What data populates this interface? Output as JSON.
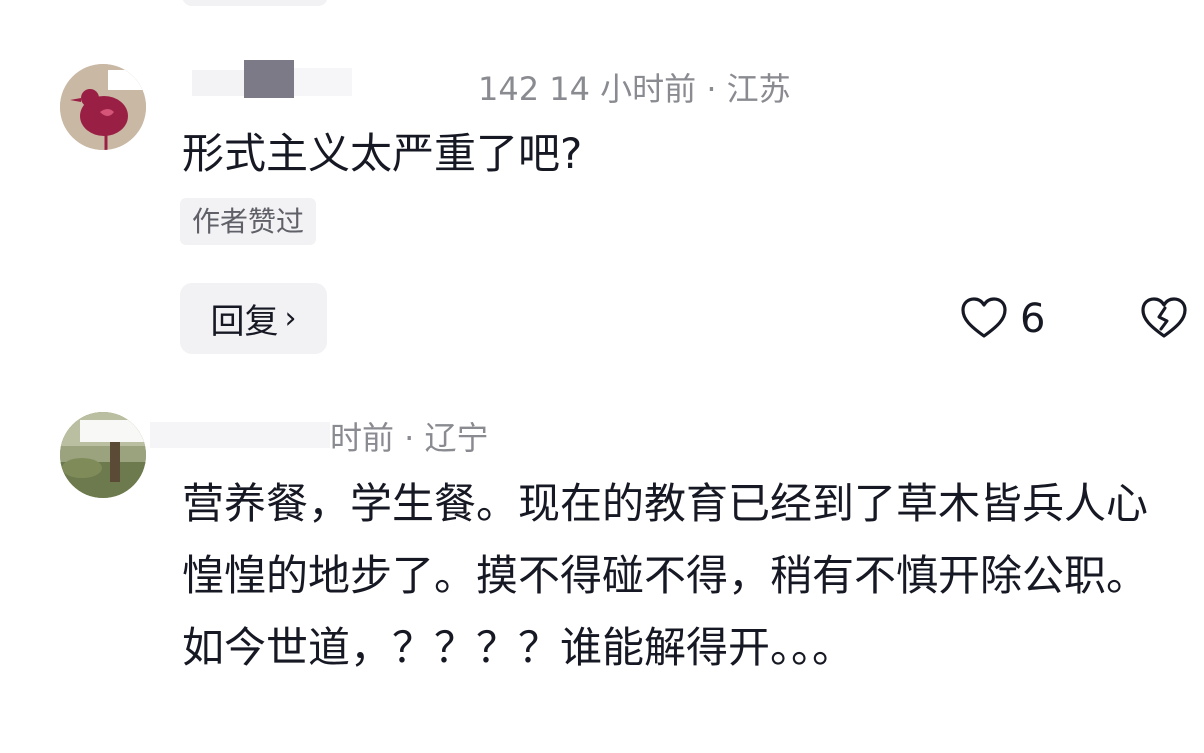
{
  "comments": [
    {
      "meta": "142  14 小时前 · 江苏",
      "text": "形式主义太严重了吧?",
      "badge": "作者赞过",
      "reply_label": "回复",
      "reply_chevron": "›",
      "like_count": "6",
      "icons": {
        "like": "heart-outline-icon",
        "dislike": "broken-heart-icon",
        "reply": "chevron-right-icon"
      }
    },
    {
      "meta": "时前 · 辽宁",
      "text": "营养餐，学生餐。现在的教育已经到了草木皆兵人心惶惶的地步了。摸不得碰不得，稍有不慎开除公职。如今世道，？？？？谁能解得开。。。"
    }
  ],
  "colors": {
    "text": "#161823",
    "meta": "#8a8b91",
    "chip_bg": "#f2f2f4",
    "badge_text": "#5f6068"
  }
}
